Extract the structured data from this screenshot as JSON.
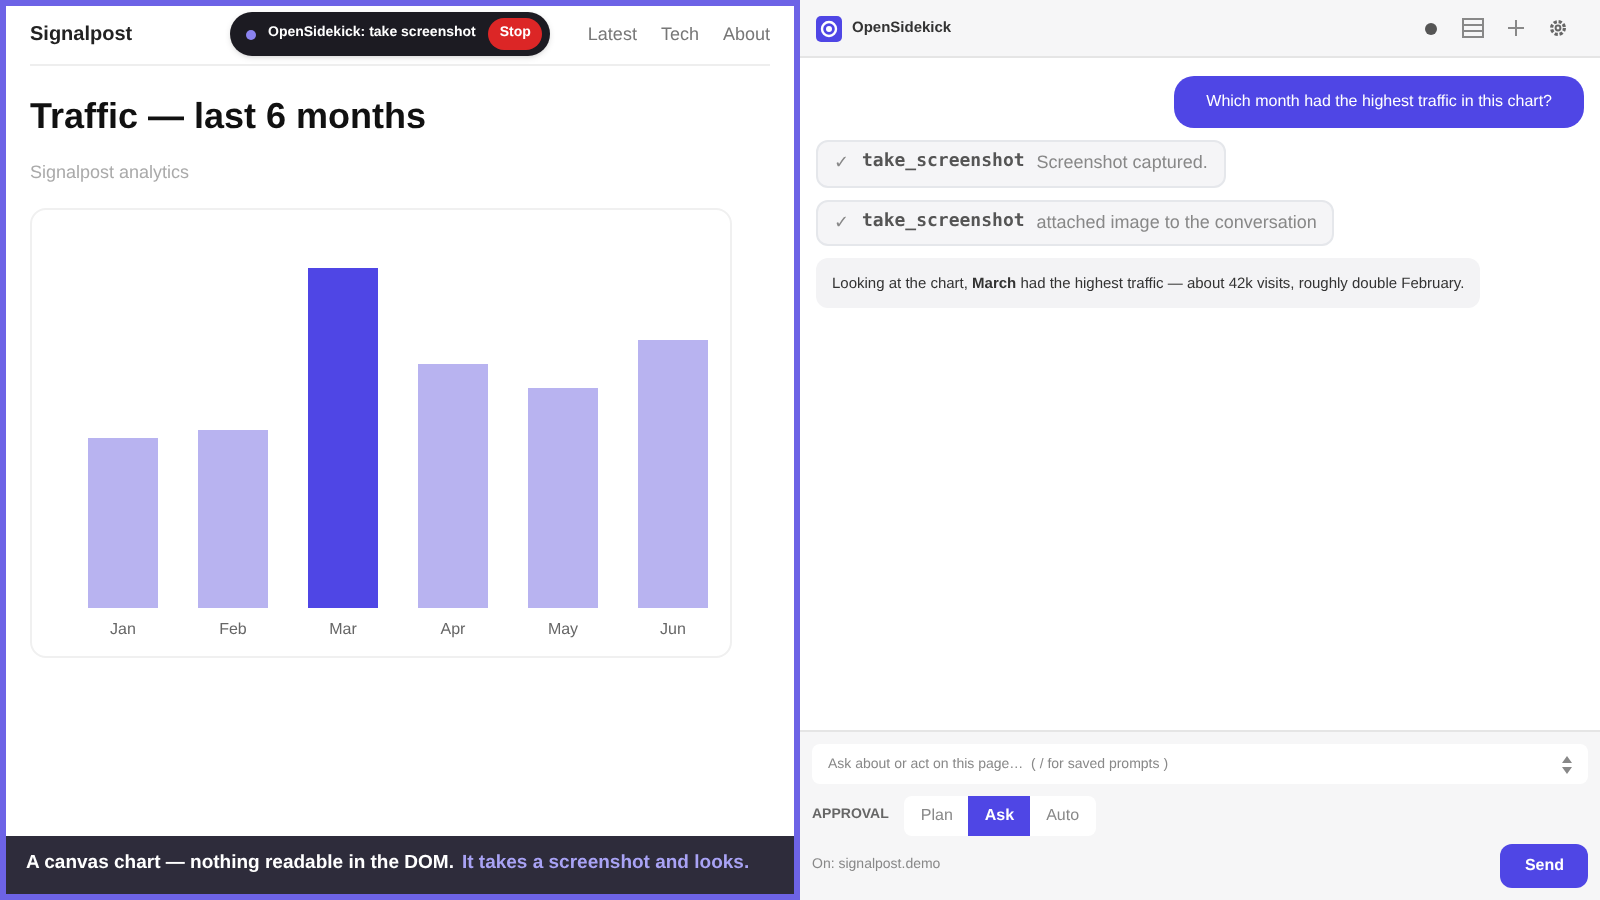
{
  "site": {
    "brand": "Signalpost",
    "nav": [
      "Latest",
      "Tech",
      "About"
    ],
    "title": "Traffic — last 6 months",
    "subtitle": "Signalpost analytics"
  },
  "recording_pill": {
    "label": "OpenSidekick: take screenshot",
    "stop": "Stop"
  },
  "chart": {
    "bars": [
      {
        "label": "Jan",
        "selected": false
      },
      {
        "label": "Feb",
        "selected": false
      },
      {
        "label": "Mar",
        "selected": true
      },
      {
        "label": "Apr",
        "selected": false
      },
      {
        "label": "May",
        "selected": false
      },
      {
        "label": "Jun",
        "selected": false
      }
    ]
  },
  "caption": {
    "lead": "A canvas chart — nothing readable in the DOM.",
    "emphasis": "It takes a screenshot and looks."
  },
  "panel": {
    "title": "OpenSidekick",
    "messages": [
      {
        "kind": "user",
        "text": "Which month had the highest traffic in this chart?"
      },
      {
        "kind": "tool",
        "check": "✓",
        "tool": "take_screenshot",
        "text": "Screenshot captured."
      },
      {
        "kind": "tool",
        "check": "✓",
        "tool": "take_screenshot",
        "text": "attached image to the conversation"
      },
      {
        "kind": "assistant",
        "text": "Looking at the chart, **March** had the highest traffic — about 42k visits, roughly double February."
      }
    ],
    "input": {
      "placeholder": "Ask about or act on this page…  ( / for saved prompts )"
    },
    "approval": {
      "label": "APPROVAL",
      "options": [
        {
          "label": "Plan",
          "selected": false
        },
        {
          "label": "Ask",
          "selected": true
        },
        {
          "label": "Auto",
          "selected": false
        }
      ]
    },
    "origin": "On: signalpost.demo",
    "send": "Send"
  }
}
